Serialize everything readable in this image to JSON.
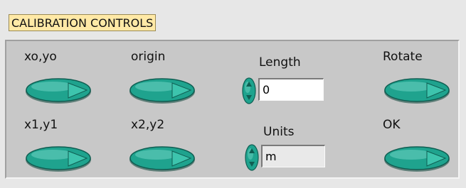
{
  "panel": {
    "title": "CALIBRATION CONTROLS"
  },
  "buttons": {
    "xo_yo": "xo,yo",
    "origin": "origin",
    "rotate": "Rotate",
    "x1_y1": "x1,y1",
    "x2_y2": "x2,y2",
    "ok": "OK"
  },
  "length": {
    "label": "Length",
    "value": "0"
  },
  "units": {
    "label": "Units",
    "value": "m"
  },
  "colors": {
    "button": "#1fa38e",
    "panel": "#c8c8c8",
    "tag": "#ffe9a6"
  }
}
